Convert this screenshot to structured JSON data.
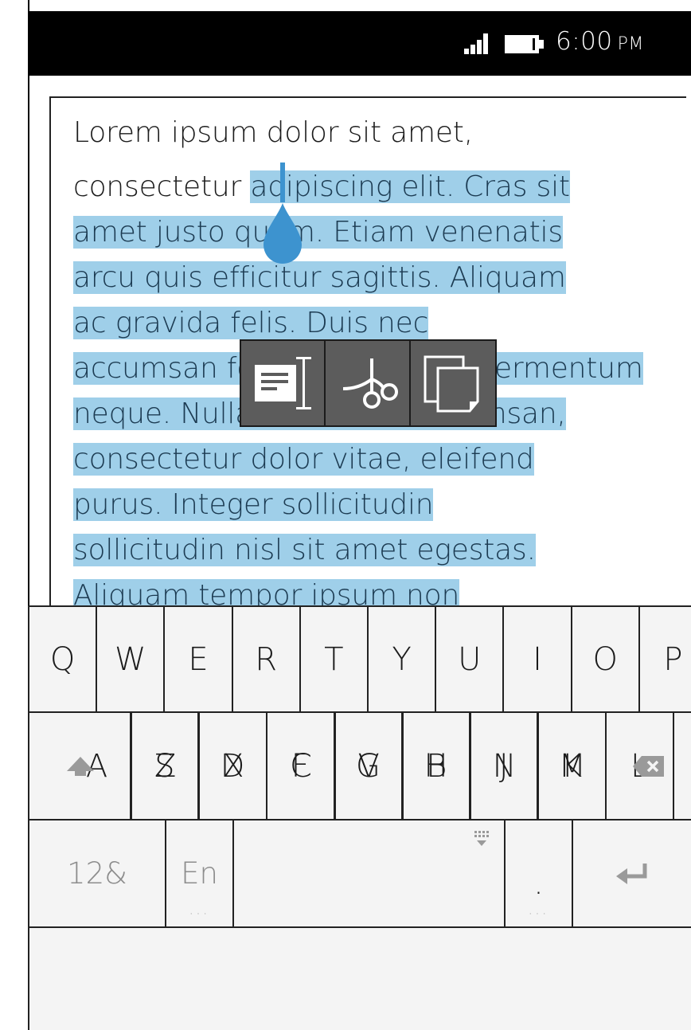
{
  "status": {
    "time": "6:00",
    "ampm": "PM"
  },
  "editor": {
    "lines": [
      {
        "plain": "Lorem ipsum dolor sit amet,",
        "selected": ""
      },
      {
        "plain": "consectetur ",
        "selected": "adipiscing elit. Cras sit"
      },
      {
        "plain": "",
        "selected": "amet justo quam. Etiam venenatis"
      },
      {
        "plain": "",
        "selected": "arcu quis efficitur sagittis. Aliquam"
      },
      {
        "plain": "",
        "selected": "ac gravida felis. Duis nec"
      },
      {
        "plain": "",
        "selected": "accumsan fermentum dolor, fermentum"
      },
      {
        "plain": "",
        "selected": "neque. Nullam in libero accumsan,"
      },
      {
        "plain": "",
        "selected": "consectetur dolor vitae, eleifend"
      },
      {
        "plain": "",
        "selected": "purus. Integer sollicitudin"
      },
      {
        "plain": "",
        "selected": "sollicitudin nisl sit amet egestas."
      },
      {
        "plain": "",
        "selected": "Aliquam tempor ipsum non"
      }
    ]
  },
  "context_menu": [
    {
      "action": "select-all",
      "icon": "select-all-icon"
    },
    {
      "action": "cut",
      "icon": "scissors-icon"
    },
    {
      "action": "copy",
      "icon": "copy-icon"
    }
  ],
  "keyboard": {
    "row1": [
      "Q",
      "W",
      "E",
      "R",
      "T",
      "Y",
      "U",
      "I",
      "O",
      "P"
    ],
    "row2": [
      "A",
      "S",
      "D",
      "F",
      "G",
      "H",
      "J",
      "K",
      "L"
    ],
    "row3": [
      "Z",
      "X",
      "C",
      "V",
      "B",
      "N",
      "M"
    ],
    "row4": {
      "symbols": "12&",
      "language": "En",
      "period": "."
    }
  }
}
